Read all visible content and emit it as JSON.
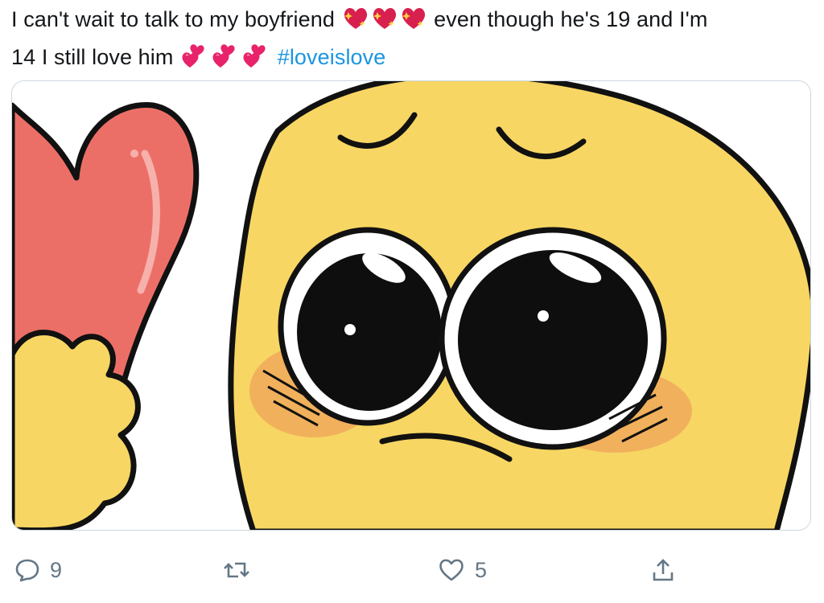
{
  "tweet": {
    "text_line1_a": "I can't wait to talk to my boyfriend",
    "text_line1_b": "even though he's 19 and I'm",
    "text_line2_a": "14 I still love him",
    "hashtag": "#loveislove",
    "emojis_line1": [
      "sparkling-heart-icon",
      "sparkling-heart-icon",
      "sparkling-heart-icon"
    ],
    "emojis_line2": [
      "two-hearts-icon",
      "two-hearts-icon",
      "two-hearts-icon"
    ]
  },
  "media": {
    "alt": "pleading face emoji holding a heart",
    "colors": {
      "face": "#f7d663",
      "heart": "#ec6f67",
      "blush": "#f0a95a",
      "outline": "#111111"
    }
  },
  "actions": {
    "reply_count": "9",
    "retweet_count": "",
    "like_count": "5",
    "icons": [
      "reply-icon",
      "retweet-icon",
      "like-icon",
      "share-icon"
    ],
    "icon_color": "#657786"
  }
}
